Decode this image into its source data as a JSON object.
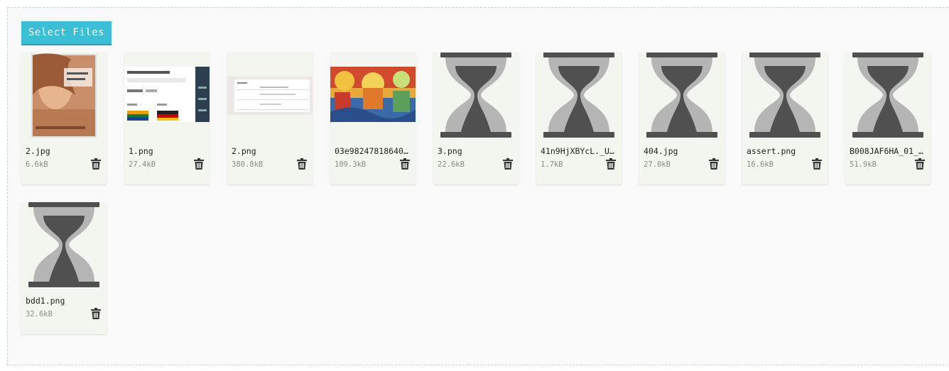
{
  "uploader": {
    "select_label": "Select Files"
  },
  "files": [
    {
      "name": "2.jpg",
      "size": "6.6kB",
      "thumb": "book-cover"
    },
    {
      "name": "1.png",
      "size": "27.4kB",
      "thumb": "screenshot-flags"
    },
    {
      "name": "2.png",
      "size": "380.8kB",
      "thumb": "screenshot-doc"
    },
    {
      "name": "03e98247818640…",
      "size": "109.3kB",
      "thumb": "painting"
    },
    {
      "name": "3.png",
      "size": "22.6kB",
      "thumb": "hourglass-icon"
    },
    {
      "name": "41n9HjXBYcL._U…",
      "size": "1.7kB",
      "thumb": "hourglass-icon"
    },
    {
      "name": "404.jpg",
      "size": "27.0kB",
      "thumb": "hourglass-icon"
    },
    {
      "name": "assert.png",
      "size": "16.6kB",
      "thumb": "hourglass-icon"
    },
    {
      "name": "B008JAF6HA_01_…",
      "size": "51.9kB",
      "thumb": "hourglass-icon"
    },
    {
      "name": "bdd1.png",
      "size": "32.6kB",
      "thumb": "hourglass-icon"
    }
  ],
  "colors": {
    "button": "#3bbfd6",
    "card_bg": "#f2f6ee",
    "hourglass_dark": "#505050",
    "hourglass_light": "#b5b5b5"
  }
}
